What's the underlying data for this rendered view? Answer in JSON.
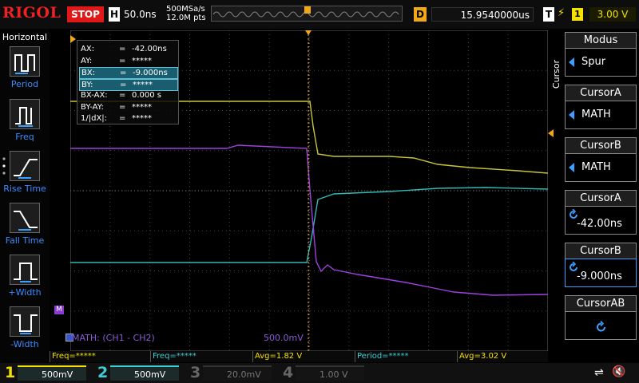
{
  "topbar": {
    "logo": "RIGOL",
    "run_state": "STOP",
    "h_label": "H",
    "timebase": "50.0ns",
    "sample_rate": "500MSa/s",
    "memory_depth": "12.0M pts",
    "d_label": "D",
    "delay": "15.9540000us",
    "t_label": "T",
    "trigger_source": "1",
    "trigger_level": "3.00 V"
  },
  "left_panel": {
    "title": "Horizontal",
    "items": [
      {
        "label": "Period",
        "icon": "period-icon"
      },
      {
        "label": "Freq",
        "icon": "freq-icon"
      },
      {
        "label": "Rise Time",
        "icon": "rise-time-icon"
      },
      {
        "label": "Fall Time",
        "icon": "fall-time-icon"
      },
      {
        "label": "+Width",
        "icon": "pos-width-icon"
      },
      {
        "label": "-Width",
        "icon": "neg-width-icon"
      }
    ]
  },
  "cursor_readout": [
    {
      "name": "AX:",
      "eq": "=",
      "value": "-42.00ns",
      "highlight": false
    },
    {
      "name": "AY:",
      "eq": "=",
      "value": "*****",
      "highlight": false
    },
    {
      "name": "BX:",
      "eq": "=",
      "value": "-9.000ns",
      "highlight": true
    },
    {
      "name": "BY:",
      "eq": "=",
      "value": "*****",
      "highlight": true
    },
    {
      "name": "BX-AX:",
      "eq": "=",
      "value": "0.000 s",
      "highlight": false
    },
    {
      "name": "BY-AY:",
      "eq": "=",
      "value": "*****",
      "highlight": false
    },
    {
      "name": "1/|dX|:",
      "eq": "=",
      "value": "*****",
      "highlight": false
    }
  ],
  "math_label": "MATH: (CH1 - CH2)",
  "math_scale": "500.0mV",
  "math_marker": "M",
  "right_panel": {
    "tab_label": "Cursor",
    "mode_title": "Modus",
    "mode_value": "Spur",
    "cursor_a_title": "CursorA",
    "cursor_a_value": "MATH",
    "cursor_b_title": "CursorB",
    "cursor_b_value": "MATH",
    "cursor_a_pos_title": "CursorA",
    "cursor_a_pos_value": "-42.00ns",
    "cursor_b_pos_title": "CursorB",
    "cursor_b_pos_value": "-9.000ns",
    "cursor_ab_title": "CursorAB"
  },
  "measurements": [
    {
      "text": "Freq=*****",
      "color": "#f4e100"
    },
    {
      "text": "Freq=*****",
      "color": "#3dcfd6"
    },
    {
      "text": "Avg=1.82 V",
      "color": "#f4e100"
    },
    {
      "text": "Period=*****",
      "color": "#3dcfd6"
    },
    {
      "text": "Avg=3.02 V",
      "color": "#f4e100"
    }
  ],
  "channels": [
    {
      "num": "1",
      "scale": "500mV",
      "color": "#f4e100",
      "active": true
    },
    {
      "num": "2",
      "scale": "500mV",
      "color": "#3dcfd6",
      "active": true
    },
    {
      "num": "3",
      "scale": "20.0mV",
      "color": "#b04aa8",
      "active": false
    },
    {
      "num": "4",
      "scale": "1.00 V",
      "color": "#3a56c8",
      "active": false
    }
  ],
  "colors": {
    "ch1": "#c8c43a",
    "ch2": "#33b7b7",
    "math": "#a040e0",
    "accent_blue": "#3aa0ff"
  }
}
